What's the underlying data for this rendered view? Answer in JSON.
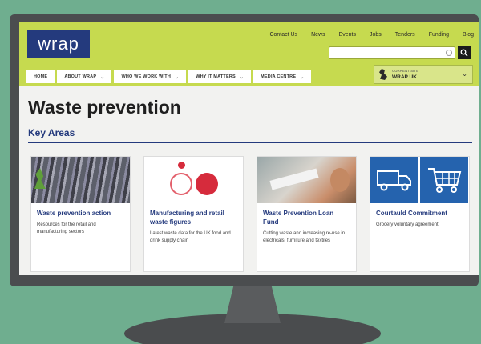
{
  "top_links": [
    "Contact Us",
    "News",
    "Events",
    "Jobs",
    "Tenders",
    "Funding",
    "Blog"
  ],
  "brand": {
    "logo_text": "wrap"
  },
  "nav": [
    {
      "label": "HOME",
      "has_dropdown": false
    },
    {
      "label": "ABOUT WRAP",
      "has_dropdown": true
    },
    {
      "label": "WHO WE WORK WITH",
      "has_dropdown": true
    },
    {
      "label": "WHY IT MATTERS",
      "has_dropdown": true
    },
    {
      "label": "MEDIA CENTRE",
      "has_dropdown": true
    }
  ],
  "site_selector": {
    "caption": "CURRENT SITE",
    "value": "WRAP UK"
  },
  "search": {
    "placeholder": ""
  },
  "page": {
    "title": "Waste prevention",
    "section": "Key Areas"
  },
  "cards": [
    {
      "title": "Waste prevention action",
      "desc": "Resources for the retail and manufacturing sectors"
    },
    {
      "title": "Manufacturing and retail waste figures",
      "desc": "Latest waste data for the UK food and drink supply chain"
    },
    {
      "title": "Waste Prevention Loan Fund",
      "desc": "Cutting waste and increasing re-use in electricals, furniture and textiles"
    },
    {
      "title": "Courtauld Commitment",
      "desc": "Grocery voluntary agreement"
    }
  ],
  "colors": {
    "header": "#c6da4f",
    "brand_blue": "#243a7d",
    "background": "#6fae8f"
  }
}
